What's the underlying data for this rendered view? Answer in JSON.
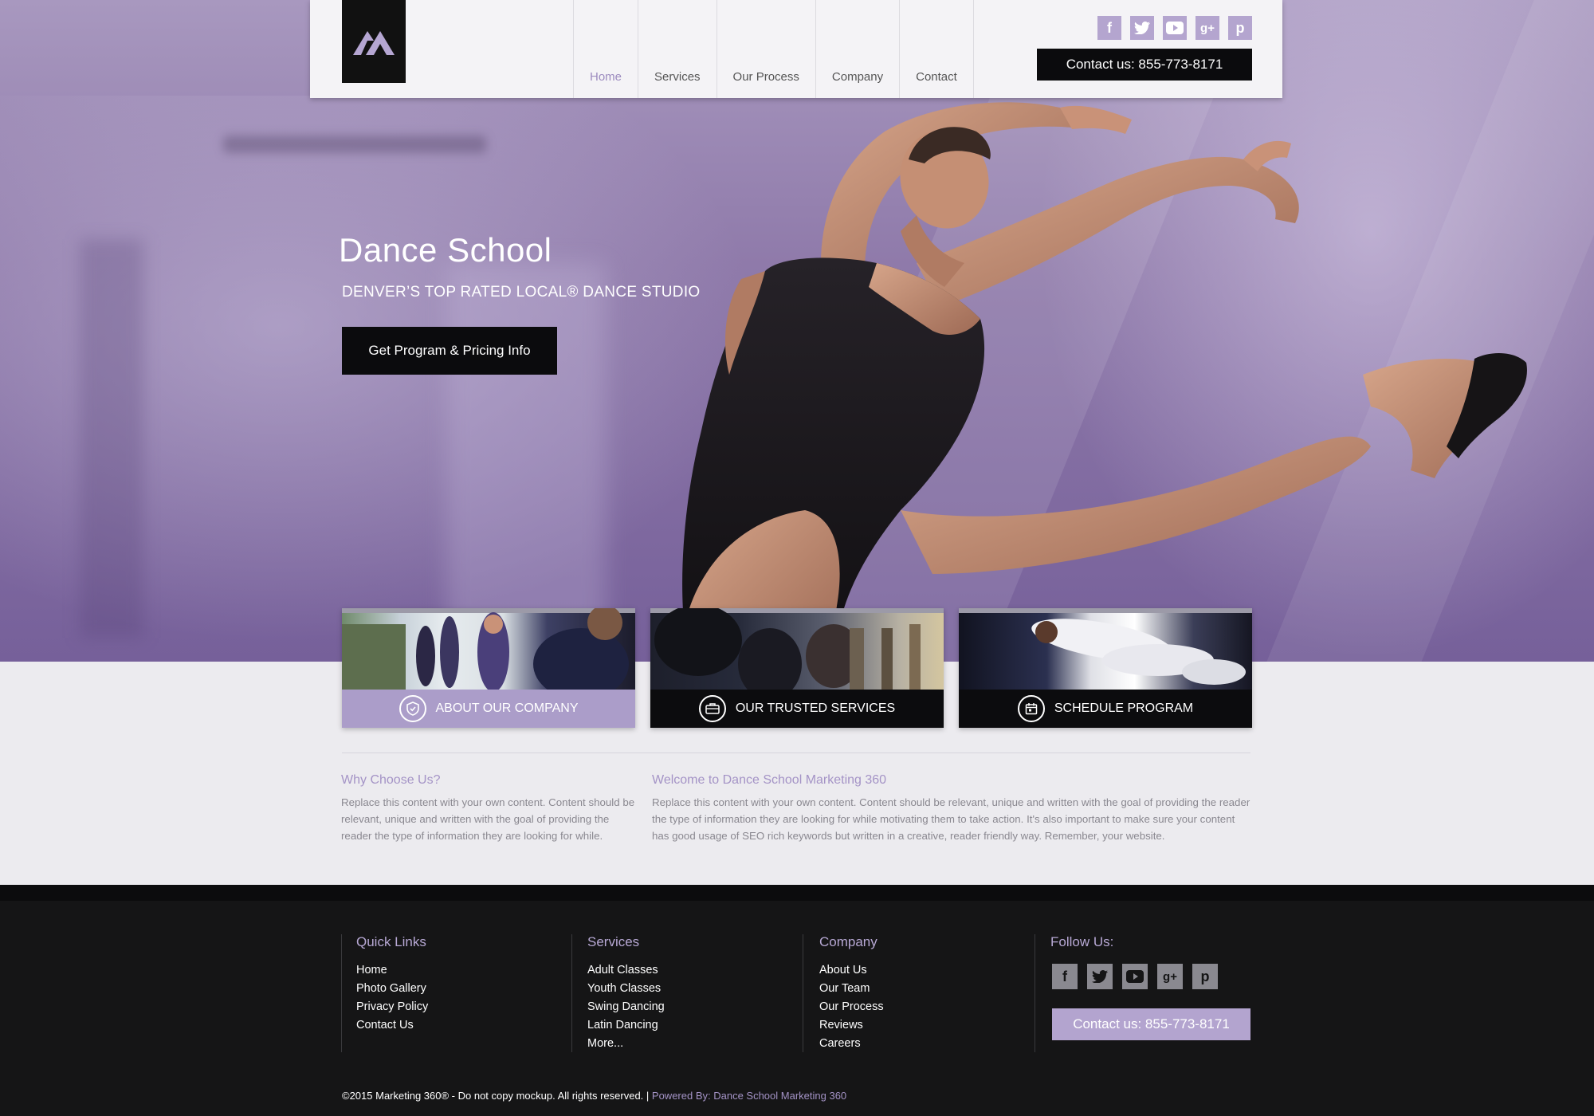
{
  "header": {
    "nav": [
      "Home",
      "Services",
      "Our Process",
      "Company",
      "Contact"
    ],
    "active_nav": "Home",
    "contact": "Contact us: 855-773-8171",
    "social": [
      "facebook-icon",
      "twitter-icon",
      "youtube-icon",
      "google-plus-icon",
      "pinterest-icon"
    ]
  },
  "hero": {
    "title": "Dance School",
    "subtitle": "DENVER’S TOP RATED LOCAL® DANCE STUDIO",
    "cta": "Get Program & Pricing Info"
  },
  "cards": [
    {
      "label": "ABOUT OUR COMPANY",
      "icon": "shield-icon",
      "bar_color": "#ab9dc9"
    },
    {
      "label": "OUR TRUSTED SERVICES",
      "icon": "briefcase-icon",
      "bar_color": "#0c0c0e"
    },
    {
      "label": "SCHEDULE PROGRAM",
      "icon": "calendar-icon",
      "bar_color": "#0c0c0e"
    }
  ],
  "content": {
    "left_heading": "Why Choose Us?",
    "left_text": "Replace this content with your own content. Content should be relevant, unique and written with the goal of providing the reader the type of information they are looking for while.",
    "right_heading": "Welcome to Dance School Marketing 360",
    "right_text": "Replace this content with your own content. Content should be relevant, unique and written with the goal of providing the reader the type of information they are looking for while motivating them to take action. It's also important to make sure your content has good usage of SEO rich keywords but written in a creative, reader friendly way. Remember, your website."
  },
  "footer": {
    "quick_links": {
      "heading": "Quick Links",
      "items": [
        "Home",
        "Photo Gallery",
        "Privacy Policy",
        "Contact Us"
      ]
    },
    "services": {
      "heading": "Services",
      "items": [
        "Adult Classes",
        "Youth Classes",
        "Swing Dancing",
        "Latin Dancing",
        "More..."
      ]
    },
    "company": {
      "heading": "Company",
      "items": [
        "About Us",
        "Our Team",
        "Our Process",
        "Reviews",
        "Careers"
      ]
    },
    "follow": {
      "heading": "Follow Us:",
      "contact": "Contact us: 855-773-8171"
    },
    "copyright": "©2015 Marketing 360® - Do not copy mockup. All rights reserved. |",
    "powered": "Powered By: Dance School Marketing 360"
  },
  "colors": {
    "accent": "#a493c6",
    "dark": "#0b0b0d",
    "footer_bg": "#151516"
  }
}
